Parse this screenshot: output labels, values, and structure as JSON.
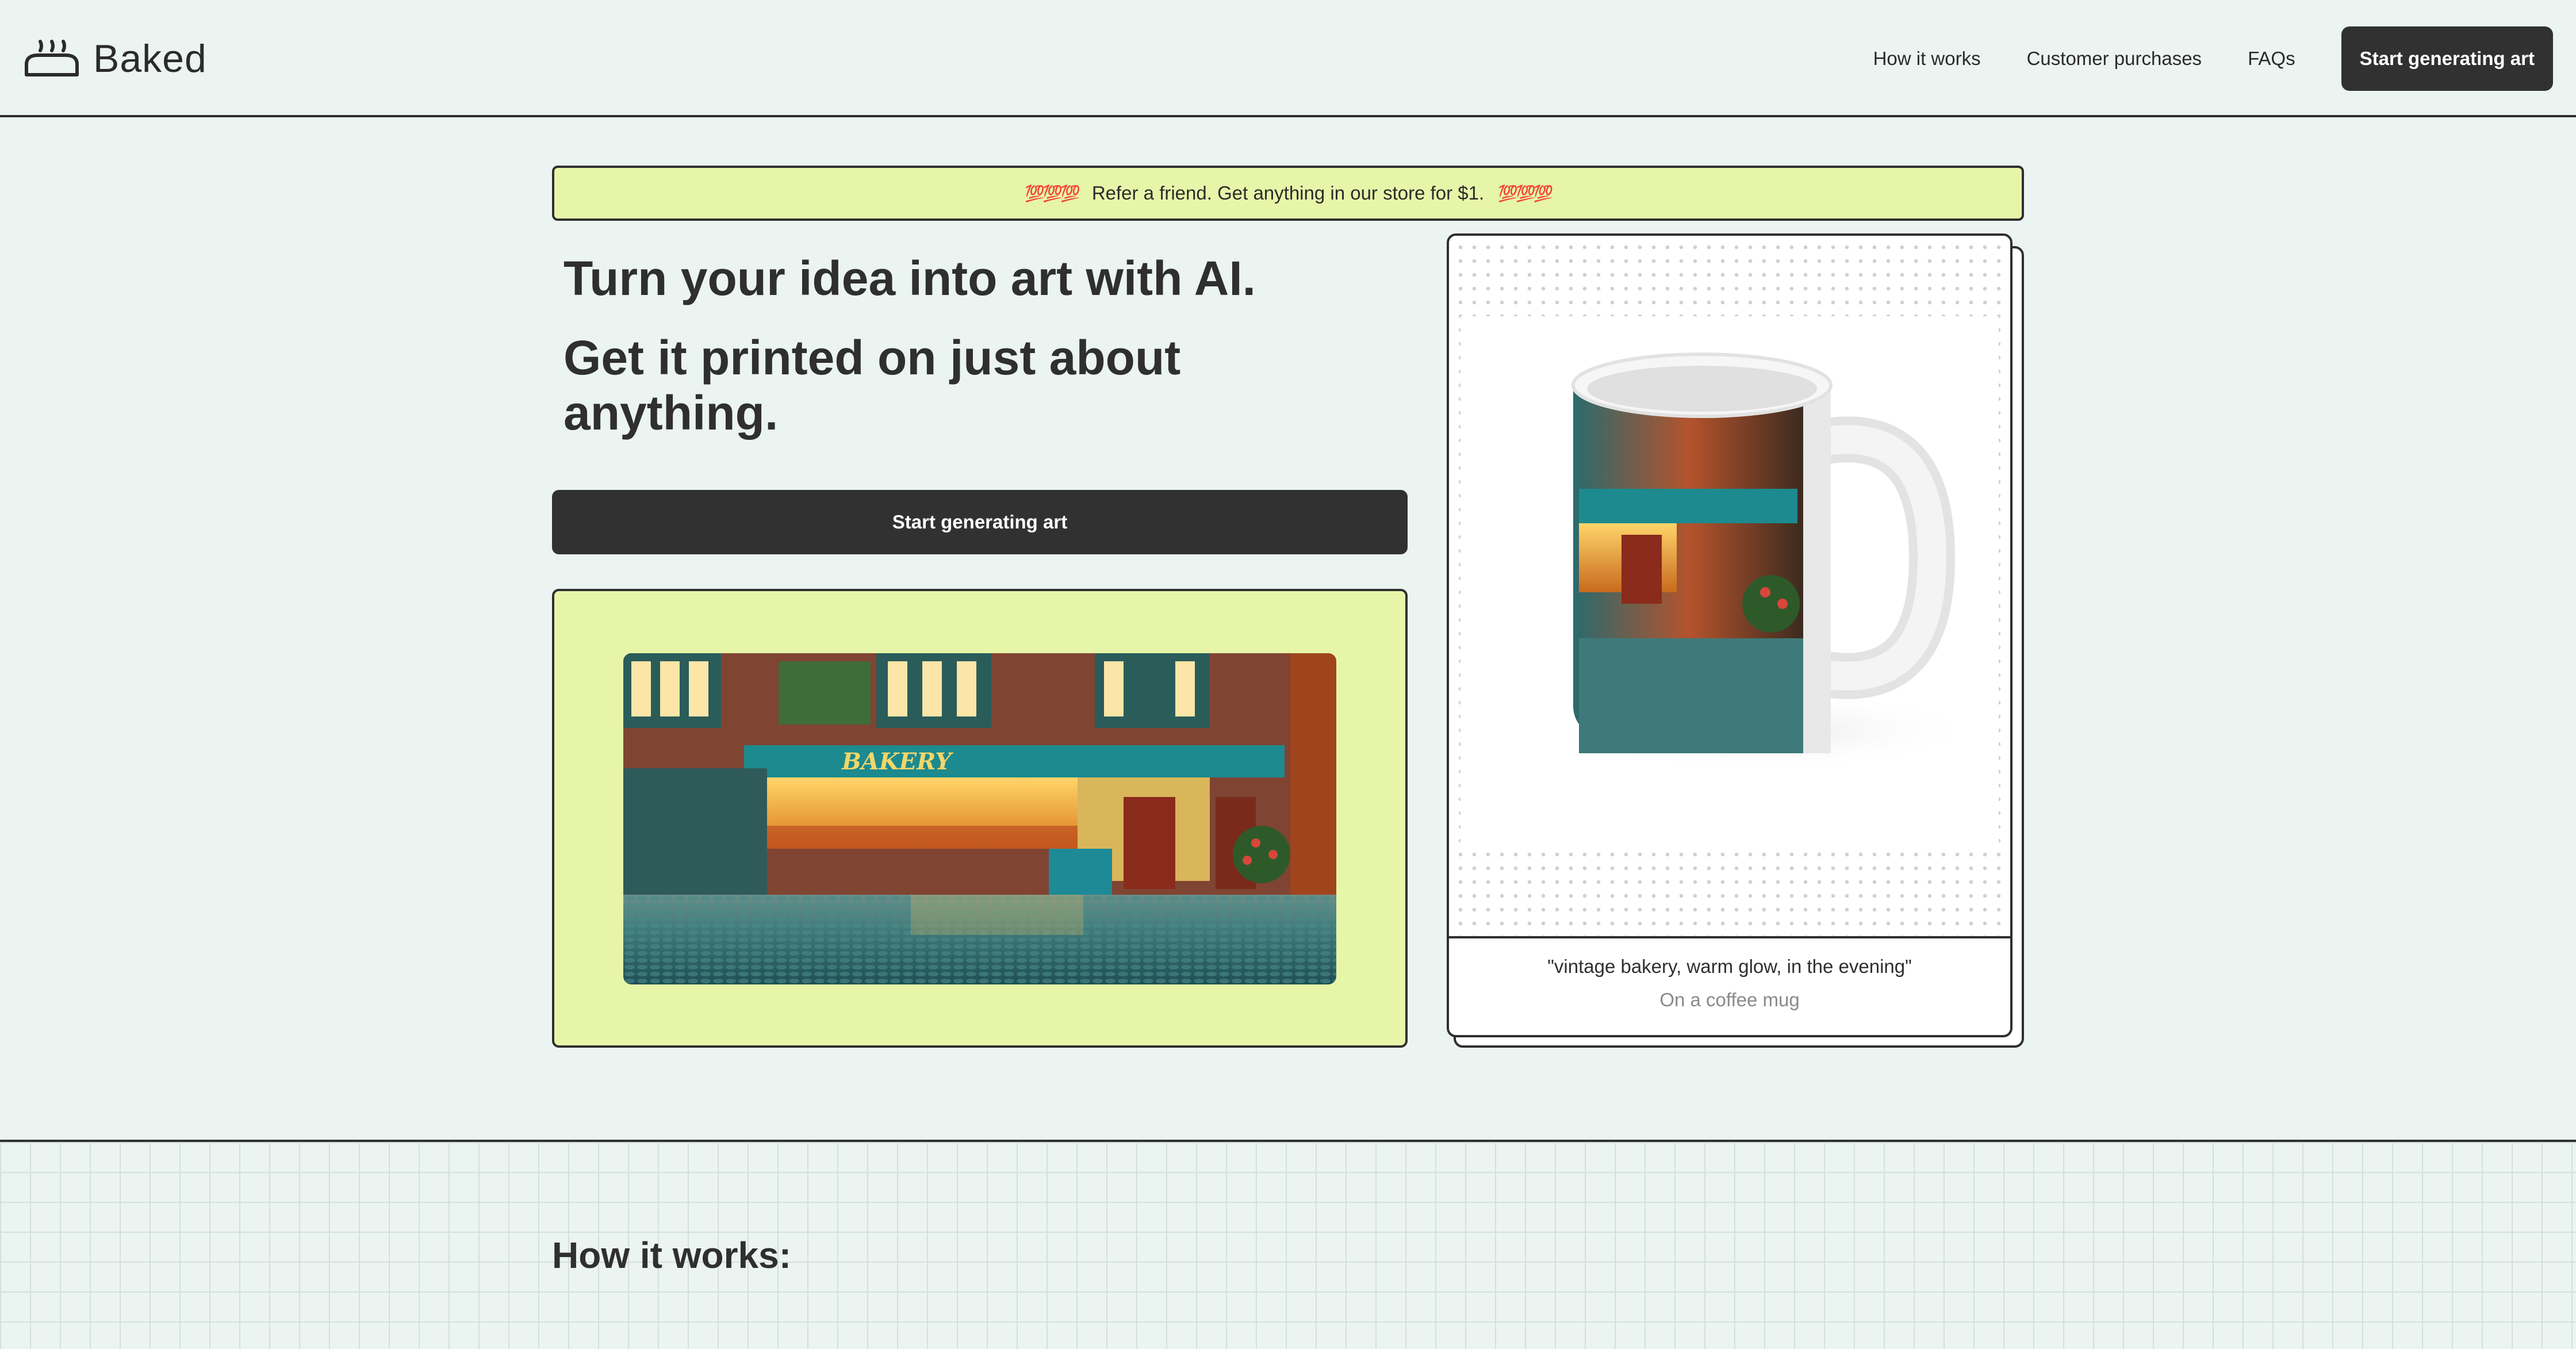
{
  "nav": {
    "brand": "Baked",
    "links": [
      "How it works",
      "Customer purchases",
      "FAQs"
    ],
    "cta": "Start generating art"
  },
  "promo": {
    "emoji": "💯💯💯",
    "text": "Refer a friend. Get anything in our store for $1."
  },
  "hero": {
    "headline": "Turn your idea into art with AI.",
    "subheadline": "Get it printed on just about anything.",
    "cta": "Start generating art",
    "art_sign": "BAKERY"
  },
  "product_card": {
    "prompt": "\"vintage bakery, warm glow, in the evening\"",
    "product": "On a coffee mug"
  },
  "how_it_works": {
    "title": "How it works:"
  },
  "colors": {
    "background": "#ebf4f0",
    "accent_yellow": "#e7f5a9",
    "dark": "#313131",
    "border": "#2f2f2f",
    "muted_text": "#8a8a8a"
  },
  "icons": [
    "bread-logo-icon",
    "hundred-points-emoji"
  ]
}
